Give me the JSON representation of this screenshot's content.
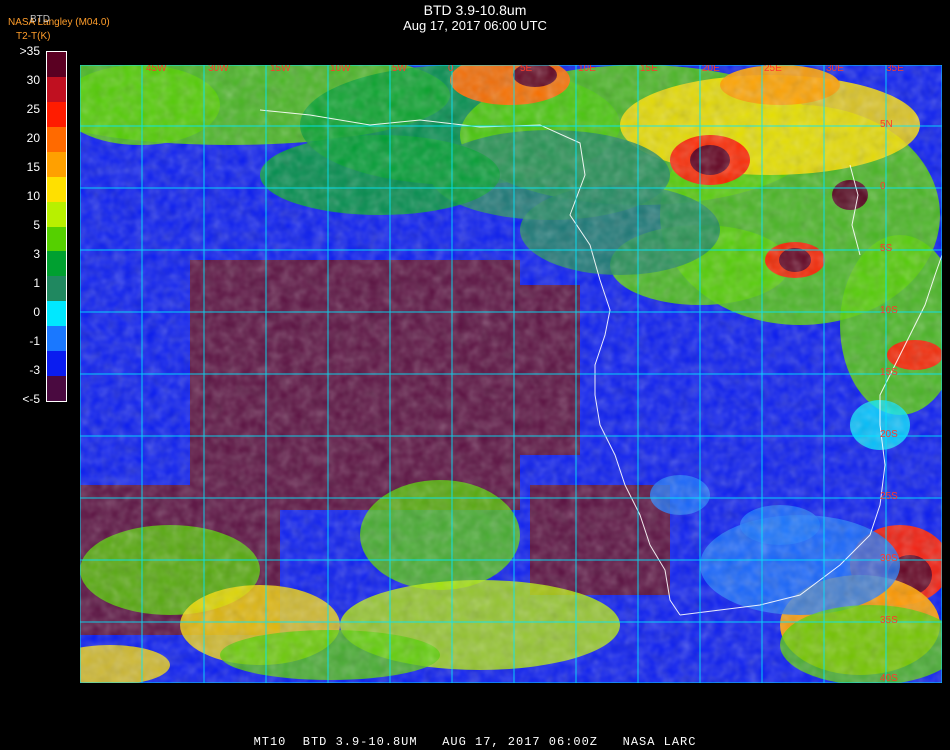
{
  "header": {
    "title": "BTD 3.9-10.8um",
    "subtitle": "Aug 17, 2017 06:00 UTC",
    "credit_line1": "NASA Langley (M04.0)",
    "credit_line2": "T2-T(K)",
    "legend_overlay": "BTD"
  },
  "legend": {
    "labels": [
      ">35",
      "30",
      "25",
      "20",
      "15",
      "10",
      "5",
      "3",
      "1",
      "0",
      "-1",
      "-3",
      "<-5"
    ],
    "colors": [
      "#5a0022",
      "#c01020",
      "#ff1c00",
      "#ff6a00",
      "#ffa000",
      "#ffe000",
      "#b8f000",
      "#55d000",
      "#00a030",
      "#208860",
      "#00e8ff",
      "#1a78ff",
      "#0a1cf0",
      "#4a0a40"
    ]
  },
  "map": {
    "lon_labels": [
      "45W",
      "30W",
      "15W",
      "10W",
      "5W",
      "0",
      "5E",
      "10E",
      "15E",
      "20E",
      "25E",
      "30E",
      "35E"
    ],
    "lat_labels": [
      "5N",
      "0",
      "5S",
      "10S",
      "15S",
      "20S",
      "25S",
      "30S",
      "35S",
      "40S"
    ],
    "grid_color": "#00e8ff",
    "ocean_color": "#5a1040",
    "clear_color": "#0a1cf0"
  },
  "footer": {
    "bottom_text": "MT10  BTD 3.9-10.8UM   AUG 17, 2017 06:00Z   NASA LARC"
  }
}
